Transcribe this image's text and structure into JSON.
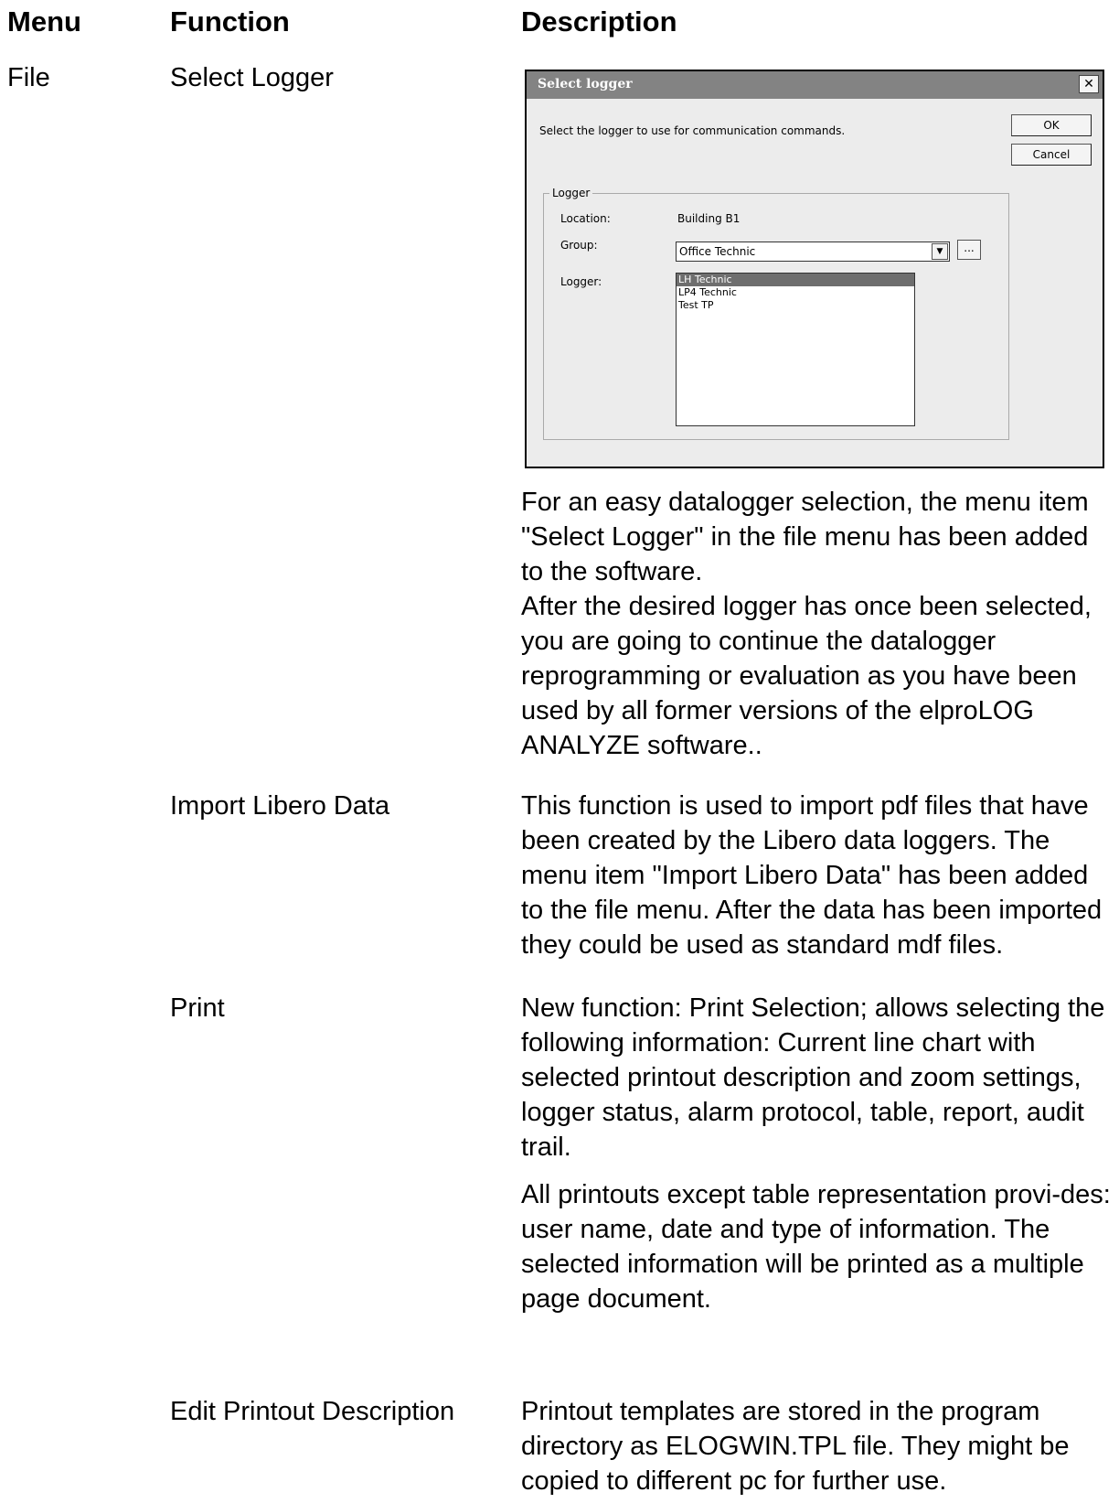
{
  "headers": {
    "menu": "Menu",
    "function": "Function",
    "description": "Description"
  },
  "rows": {
    "r1": {
      "menu": "File",
      "function": "Select Logger",
      "desc1": "For an easy datalogger selection, the menu item \"Select Logger\" in the file menu has been added to the software.",
      "desc2": "After the desired logger has once been selected, you are going to continue the datalogger reprogramming or evaluation as you have been used by all former versions of the elproLOG ANALYZE software.."
    },
    "r2": {
      "function": "Import Libero Data",
      "desc1": "This function is used to import pdf files that have been created by the Libero data loggers. The menu item \"Import Libero Data\" has been added to the file menu. After the data has been imported they could be used as standard mdf files."
    },
    "r3": {
      "function": "Print",
      "desc1": "New function: Print Selection; allows selecting the following information: Current line chart with selected printout description and zoom settings, logger status, alarm protocol, table, report, audit trail.",
      "desc2": "All printouts except table representation provi-des: user name, date and type of information. The selected information will be printed as a multiple page document."
    },
    "r4": {
      "function": "Edit Printout Description",
      "desc1": "Printout templates are stored in the program directory as ELOGWIN.TPL file. They might be copied to different pc for further use."
    }
  },
  "dialog": {
    "title": "Select logger",
    "close_glyph": "✕",
    "message": "Select the logger to use for communication commands.",
    "ok_label": "OK",
    "cancel_label": "Cancel",
    "group_label": "Logger",
    "location_label": "Location:",
    "location_value": "Building B1",
    "group_field_label": "Group:",
    "group_value": "Office Technic",
    "browse_label": "...",
    "logger_label": "Logger:",
    "loggers": {
      "l0": "LH Technic",
      "l1": "LP4 Technic",
      "l2": "Test TP"
    },
    "selected_logger": "LH Technic"
  }
}
